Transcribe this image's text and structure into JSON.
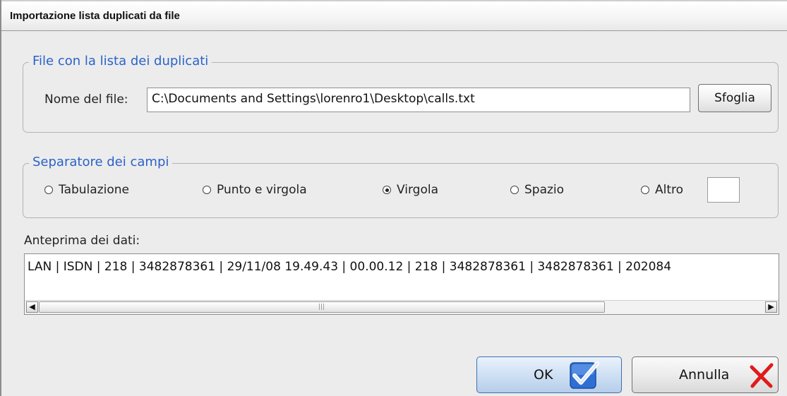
{
  "window": {
    "title": "Importazione lista duplicati da file"
  },
  "file_group": {
    "legend": "File con la lista dei duplicati",
    "filename_label": "Nome del file:",
    "filename_value": "C:\\Documents and Settings\\lorenro1\\Desktop\\calls.txt",
    "browse_label": "Sfoglia"
  },
  "separator_group": {
    "legend": "Separatore dei campi",
    "options": [
      {
        "label": "Tabulazione",
        "selected": false
      },
      {
        "label": "Punto e virgola",
        "selected": false
      },
      {
        "label": "Virgola",
        "selected": true
      },
      {
        "label": "Spazio",
        "selected": false
      },
      {
        "label": "Altro",
        "selected": false
      }
    ],
    "other_value": ""
  },
  "preview": {
    "label": "Anteprima dei dati:",
    "text": "LAN | ISDN | 218 | 3482878361 | 29/11/08 19.49.43 | 00.00.12 | 218 | 3482878361 | 3482878361 | 202084"
  },
  "buttons": {
    "ok_label": "OK",
    "cancel_label": "Annulla"
  },
  "icons": {
    "ok": "checkmark-icon",
    "cancel": "red-x-icon"
  },
  "colors": {
    "legend": "#2b62c9",
    "ok_check": "#2f6fd4",
    "cancel_x": "#e01b1b"
  }
}
